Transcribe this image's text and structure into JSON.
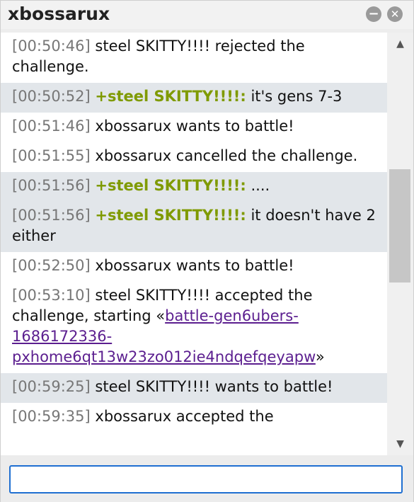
{
  "window": {
    "title": "xbossarux",
    "minimize_icon": "minus-circle-icon",
    "close_icon": "x-circle-icon"
  },
  "messages": [
    {
      "time": "[00:50:46]",
      "user": "",
      "text": "steel SKITTY!!!! rejected the challenge.",
      "shaded": false
    },
    {
      "time": "[00:50:52]",
      "user": "+steel SKITTY!!!!:",
      "text": "it's gens 7-3",
      "shaded": true
    },
    {
      "time": "[00:51:46]",
      "user": "",
      "text": "xbossarux wants to battle!",
      "shaded": false
    },
    {
      "time": "[00:51:55]",
      "user": "",
      "text": "xbossarux cancelled the challenge.",
      "shaded": false
    },
    {
      "time": "[00:51:56]",
      "user": "+steel SKITTY!!!!:",
      "text": "....",
      "shaded": true
    },
    {
      "time": "[00:51:56]",
      "user": "+steel SKITTY!!!!:",
      "text": "it doesn't have 2 either",
      "shaded": true
    },
    {
      "time": "[00:52:50]",
      "user": "",
      "text": "xbossarux wants to battle!",
      "shaded": false
    },
    {
      "time": "[00:53:10]",
      "user": "",
      "text": "steel SKITTY!!!! accepted the challenge, starting «",
      "link": "battle-gen6ubers-1686172336-pxhome6qt13w23zo012ie4ndqefqeyapw",
      "after": "»",
      "shaded": false
    },
    {
      "time": "[00:59:25]",
      "user": "",
      "text": "steel SKITTY!!!! wants to battle!",
      "shaded": true
    },
    {
      "time": "[00:59:35]",
      "user": "",
      "text": "xbossarux accepted the",
      "shaded": false
    }
  ],
  "scrollbar": {
    "up_icon": "triangle-up-icon",
    "down_icon": "triangle-down-icon"
  },
  "chat_input": {
    "value": "",
    "placeholder": ""
  }
}
